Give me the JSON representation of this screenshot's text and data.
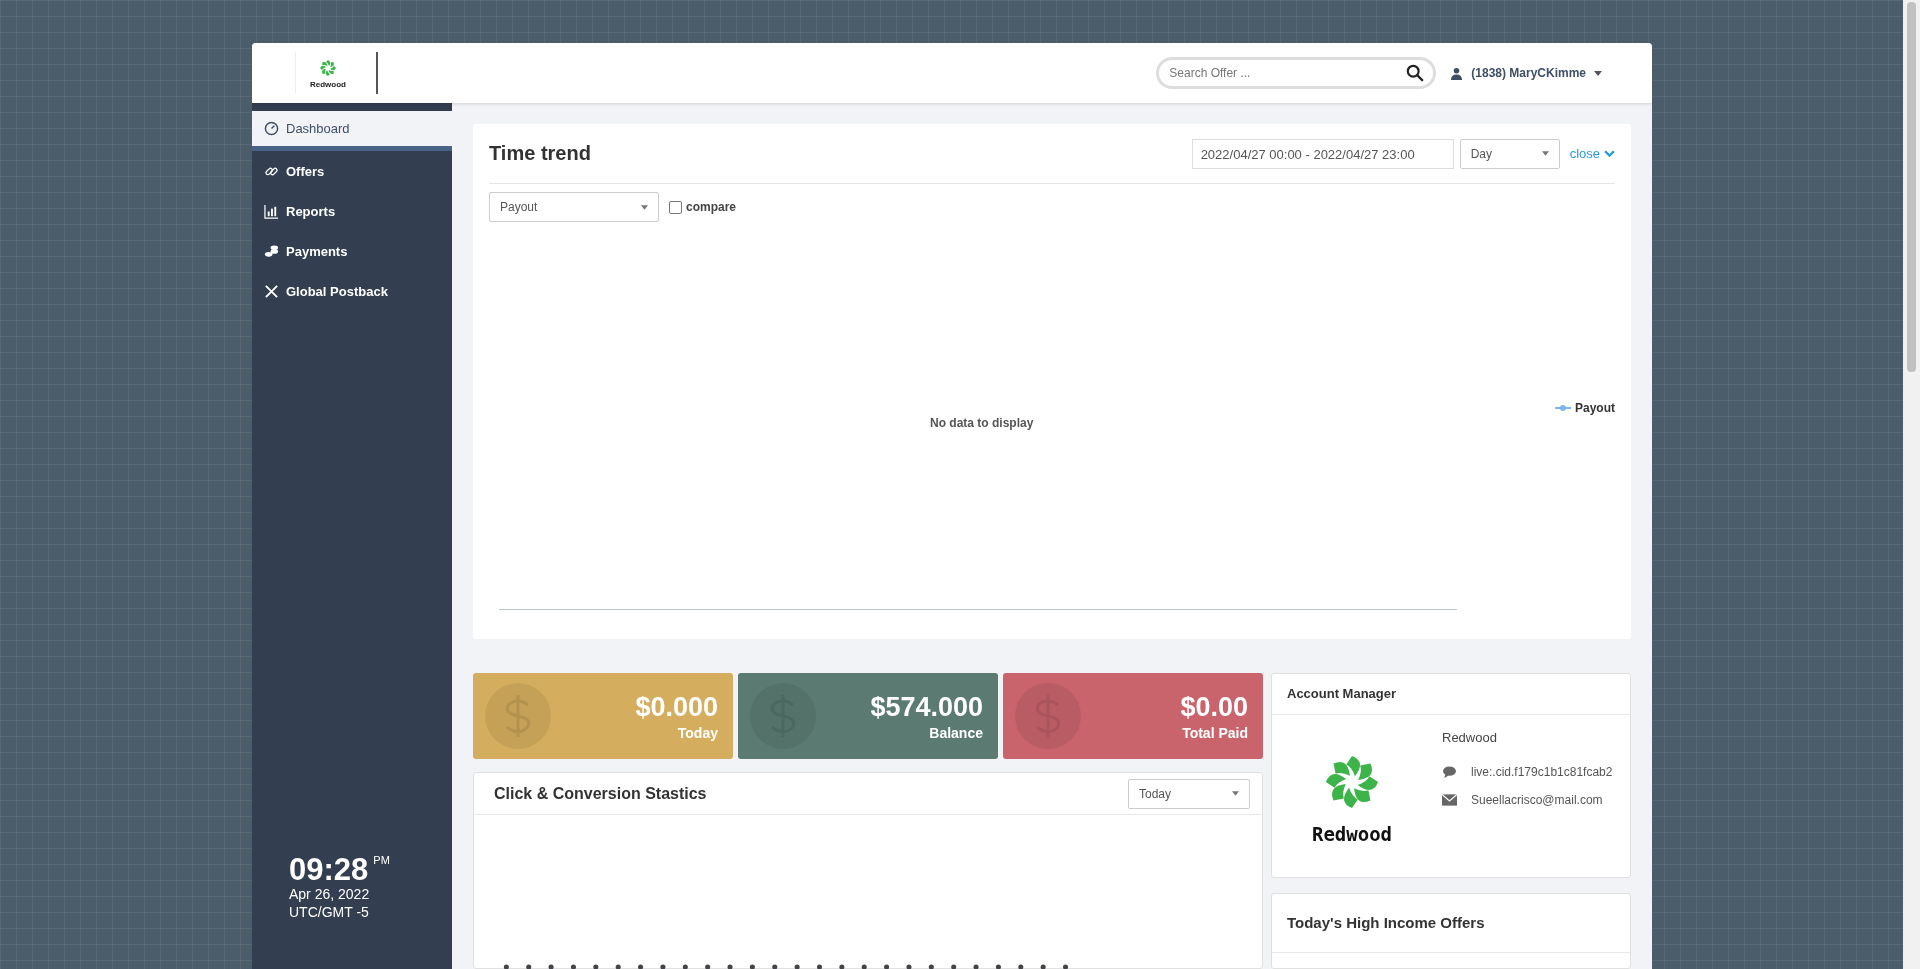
{
  "header": {
    "logo_text": "Redwood",
    "search": {
      "placeholder": "Search Offer ..."
    },
    "user": "(1838) MaryCKimme"
  },
  "sidebar": {
    "items": [
      {
        "label": "Dashboard",
        "selected": true
      },
      {
        "label": "Offers",
        "selected": false
      },
      {
        "label": "Reports",
        "selected": false
      },
      {
        "label": "Payments",
        "selected": false
      },
      {
        "label": "Global Postback",
        "selected": false
      }
    ],
    "clock": {
      "time": "09:28",
      "ampm": "PM",
      "date": "Apr 26, 2022",
      "zone": "UTC/GMT -5"
    }
  },
  "time_trend": {
    "title": "Time trend",
    "date_range": "2022/04/27 00:00 - 2022/04/27 23:00",
    "interval": "Day",
    "close": "close",
    "metric": "Payout",
    "compare": {
      "label": "compare",
      "checked": false
    },
    "empty_text": "No data to display",
    "legend": "Payout"
  },
  "stats": [
    {
      "value": "$0.000",
      "label": "Today",
      "color": "#d4ae5e"
    },
    {
      "value": "$574.000",
      "label": "Balance",
      "color": "#5b7b72"
    },
    {
      "value": "$0.00",
      "label": "Total Paid",
      "color": "#c9636c"
    }
  ],
  "click_stats": {
    "title": "Click & Conversion Stastics",
    "period": "Today"
  },
  "account_manager": {
    "title": "Account Manager",
    "name": "Redwood",
    "logo_text": "Redwood",
    "chat": "live:.cid.f179c1b1c81fcab2",
    "email": "Sueellacrisco@mail.com"
  },
  "high_income": {
    "title": "Today's High Income Offers"
  }
}
